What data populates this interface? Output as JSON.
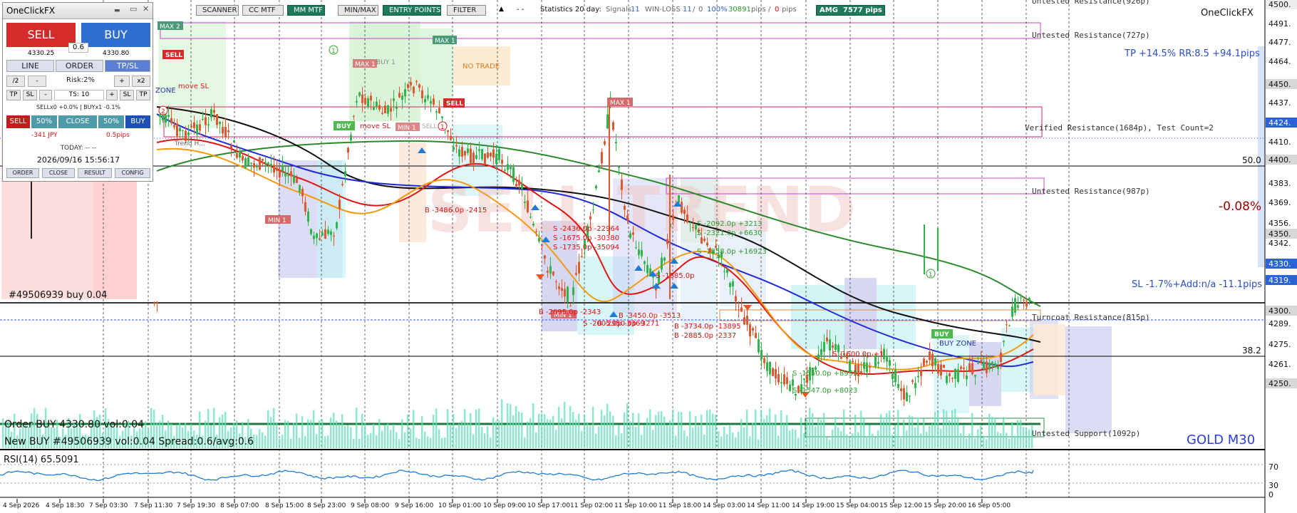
{
  "toolbar": {
    "scanner": "SCANNER",
    "cc_mtf": "CC MTF",
    "mm_mtf": "MM MTF",
    "minmax": "MIN/MAX",
    "entry_points": "ENTRY POINTS",
    "filter": "FILTER",
    "up_arrow": "▲",
    "dash": "- -",
    "stats_label": "Statistics 20 day:",
    "signals_label": "Signals",
    "signals_value": "11",
    "winloss_label": "WIN-LOSS",
    "win_value": "11",
    "winloss_sep": "/",
    "loss_value": "0",
    "win_pct": "100%",
    "pips_win": "30891",
    "pips_label": "pips",
    "pips_sep": "/",
    "pips_loss": "0",
    "pips_label2": "pips",
    "amg_label": "AMG",
    "amg_value": "7577 pips"
  },
  "panel": {
    "title": "OneClickFX",
    "minimize": "▬",
    "restore": "▭",
    "close": "✕",
    "sell": "SELL",
    "buy": "BUY",
    "spread": "0.6",
    "sell_price": "4330.25",
    "buy_price": "4330.80",
    "tabs": [
      "LINE",
      "ORDER",
      "TP/SL"
    ],
    "row1": [
      "/2",
      "-",
      "Risk:2%",
      "+",
      "x2"
    ],
    "row2": [
      "TP",
      "SL",
      "-",
      "TS: 10",
      "+",
      "SL",
      "TP"
    ],
    "status_line": "SELLx0 +0.0% | BUYx1 -0.1%",
    "row3": [
      "SELL",
      "50%",
      "CLOSE",
      "50%",
      "BUY"
    ],
    "sub_left": "-341 JPY",
    "sub_right": "0.5pips",
    "today": "TODAY: -- --",
    "datetime": "2026/09/16  15:56:17",
    "bottom_tabs": [
      "ORDER",
      "CLOSE",
      "RESULT",
      "CONFIG"
    ]
  },
  "chart": {
    "brand": "OneClickFX",
    "symbol": "GOLD M30",
    "watermark": "SELL TREND",
    "tp_text": "TP +14.5% RR:8.5 +94.1pips",
    "sl_text": "SL -1.7%+Add:n/a -11.1pips",
    "pct_text": "-0.08%",
    "order_text": "#49506939 buy 0.04",
    "bottom_order1": "Order BUY 4330.80 vol:0.04",
    "bottom_order2": "New BUY #49506939 vol:0.04 Spread:0.6/avg:0.6",
    "fib50": "50.0",
    "fib382": "38.2",
    "zones": {
      "untested_top": "Untested Resistance(926p)",
      "untested_727": "Untested Resistance(727p)",
      "verified": "Verified Resistance(1684p), Test Count=2",
      "untested_987": "Untested Resistance(987p)",
      "turncoat": "Turncoat Resistance(815p)",
      "support": "Untested Support(1092p)"
    },
    "tags": {
      "max2": "MAX 2",
      "sell1": "SELL",
      "zone": "ZONE",
      "move_sl": "move SL",
      "max1a": "MAX 1",
      "max1b": "MAX 1",
      "max1c": "MAX 1",
      "buy1": "BUY",
      "move_sl2": "move SL",
      "min1a": "MIN 1",
      "sell2": "SELL",
      "no_trade": "NO TRADE",
      "min1b": "MIN 1",
      "min1c": "MIN 1",
      "buy2": "BUY",
      "buy_zone": "BUY ZONE",
      "trend": "Trend H...",
      "buy_faded": "BUY 1",
      "sell_faded": "SELL",
      "c1": "1",
      "c2": "2",
      "c3": "1",
      "c4": "1"
    },
    "trade_labels": [
      "B -3486.0p -2415",
      "S -2436.0p -22964",
      "S -1675.0p -30380",
      "S -1735.0p -35094",
      "B -2095.0p -2343",
      "S -2005.0p -3369",
      "B -3450.0p -3513",
      "B -2950.0p -3271",
      "B -3734.0p -13895",
      "B -2885.0p -2337",
      "S -1885.0p",
      "S -2092.0p +3213",
      "S -2321.0p +6630",
      "S -1858.0p +16923",
      "S -1550.0p +8935",
      "S -1547.0p +8023",
      "S -1500.0p +1"
    ],
    "price_labels": [
      "4500.",
      "4491.",
      "4477.",
      "4464.",
      "4450.",
      "4437.",
      "4424.",
      "4410.",
      "4400.",
      "4383.",
      "4369.",
      "4356.",
      "4350.",
      "4342.",
      "4330.",
      "4319.",
      "4300.",
      "4289.",
      "4275.",
      "4261.",
      "4250."
    ],
    "time_labels": [
      "4 Sep 2026",
      "4 Sep 18:30",
      "7 Sep 03:30",
      "7 Sep 11:30",
      "7 Sep 19:30",
      "8 Sep 07:00",
      "8 Sep 15:00",
      "8 Sep 23:00",
      "9 Sep 08:00",
      "9 Sep 16:00",
      "10 Sep 01:00",
      "10 Sep 09:00",
      "10 Sep 17:00",
      "11 Sep 02:00",
      "11 Sep 10:00",
      "11 Sep 18:00",
      "14 Sep 03:00",
      "14 Sep 11:00",
      "14 Sep 19:00",
      "15 Sep 04:00",
      "15 Sep 12:00",
      "15 Sep 20:00",
      "16 Sep 05:00"
    ],
    "rsi": {
      "label": "RSI(14) 65.5091",
      "levels": [
        "70",
        "30",
        "0"
      ],
      "value": 65.5091
    }
  }
}
